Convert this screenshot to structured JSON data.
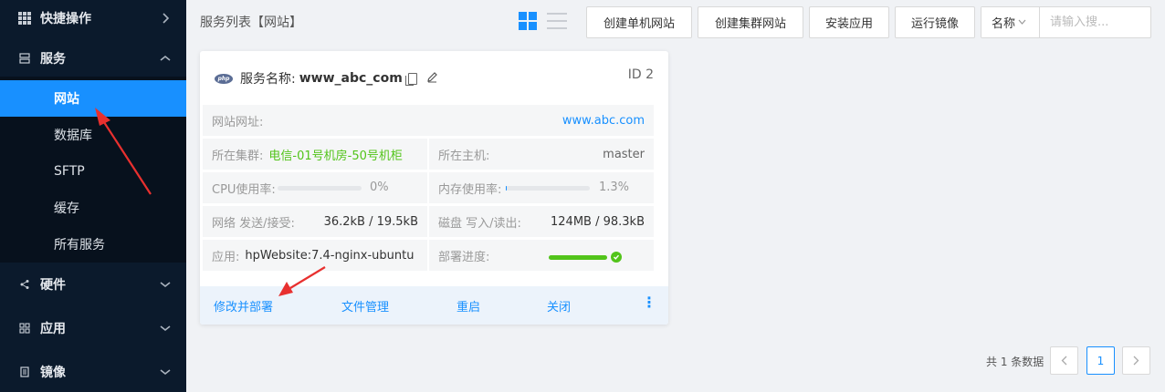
{
  "sidebar": {
    "quick_ops": {
      "label": "快捷操作"
    },
    "services": {
      "label": "服务"
    },
    "sub_items": [
      {
        "label": "网站"
      },
      {
        "label": "数据库"
      },
      {
        "label": "SFTP"
      },
      {
        "label": "缓存"
      },
      {
        "label": "所有服务"
      }
    ],
    "hardware": {
      "label": "硬件"
    },
    "apps": {
      "label": "应用"
    },
    "images": {
      "label": "镜像"
    }
  },
  "header": {
    "title": "服务列表【网站】",
    "buttons": [
      "创建单机网站",
      "创建集群网站",
      "安装应用",
      "运行镜像"
    ],
    "search": {
      "field": "名称",
      "placeholder": "请输入搜..."
    }
  },
  "card": {
    "logo_text": "php",
    "name_label": "服务名称:",
    "name": "www_abc_com",
    "id": "ID 2",
    "site_url": {
      "label": "网站网址:",
      "value": "www.abc.com"
    },
    "cluster": {
      "label": "所在集群:",
      "value": "电信-01号机房-50号机柜"
    },
    "host": {
      "label": "所在主机:",
      "value": "master"
    },
    "cpu": {
      "label": "CPU使用率:",
      "value": "0%",
      "fraction": 0.0
    },
    "memory": {
      "label": "内存使用率:",
      "value": "1.3%",
      "fraction": 0.013
    },
    "network": {
      "label": "网络 发送/接受:",
      "value": "36.2kB / 19.5kB"
    },
    "disk": {
      "label": "磁盘 写入/读出:",
      "value": "124MB / 98.3kB"
    },
    "app": {
      "label": "应用:",
      "value": "hpWebsite:7.4-nginx-ubuntu"
    },
    "deploy": {
      "label": "部署进度:",
      "fraction": 1.0
    },
    "footer": {
      "modify": "修改并部署",
      "files": "文件管理",
      "restart": "重启",
      "close": "关闭",
      "more": "⋮"
    }
  },
  "pagination": {
    "total": "共 1 条数据",
    "current": "1"
  },
  "colors": {
    "accent": "#1890ff",
    "sidebar_bg": "#0b1a2c",
    "success": "#52c41a",
    "annotation": "#e8302f"
  }
}
